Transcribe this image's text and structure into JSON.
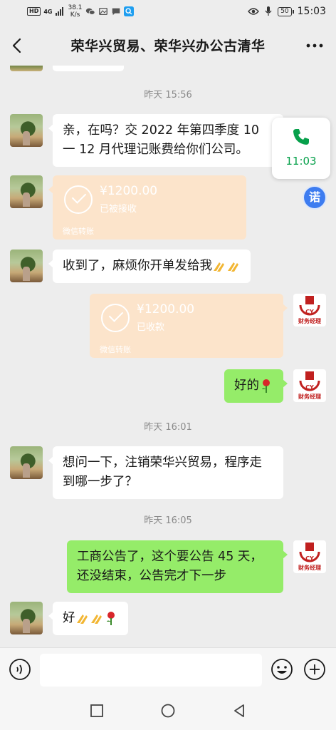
{
  "status_bar": {
    "network_hd": "HD",
    "network_4g": "4G",
    "speed_value": "38.1",
    "speed_unit": "K/s",
    "battery": "50",
    "clock": "15:03"
  },
  "header": {
    "title": "荣华兴贸易、荣华兴办公古清华"
  },
  "messages": [
    {
      "type": "time",
      "text": "昨天 15:56"
    },
    {
      "type": "text",
      "side": "left",
      "text": "亲，在吗？交 2022 年第四季度 10 一 12 月代理记账费给你们公司。"
    },
    {
      "type": "transfer",
      "side": "left",
      "amount": "¥1200.00",
      "status": "已被接收",
      "footer": "微信转账"
    },
    {
      "type": "text",
      "side": "left",
      "text": "收到了，麻烦你开单发给我"
    },
    {
      "type": "transfer",
      "side": "right",
      "amount": "¥1200.00",
      "status": "已收款",
      "footer": "微信转账"
    },
    {
      "type": "text",
      "side": "right",
      "text": "好的"
    },
    {
      "type": "time",
      "text": "昨天 16:01"
    },
    {
      "type": "text",
      "side": "left",
      "text": "想问一下，注销荣华兴贸易，程序走到哪一步了？"
    },
    {
      "type": "time",
      "text": "昨天 16:05"
    },
    {
      "type": "text",
      "side": "right",
      "text": "工商公告了，这个要公告 45 天，还没结束，公告完才下一步"
    },
    {
      "type": "text",
      "side": "left",
      "text": "好"
    }
  ],
  "avatar_right_caption": "财务经理",
  "avatar_right_logo_text": "CY",
  "call_widget": {
    "time": "11:03"
  },
  "side_badge": "诺",
  "input": {
    "placeholder": ""
  },
  "colors": {
    "background": "#ededed",
    "my_bubble": "#95ec69",
    "transfer": "#fce4cb",
    "call_green": "#07a04b",
    "badge_blue": "#3d7cf0"
  }
}
